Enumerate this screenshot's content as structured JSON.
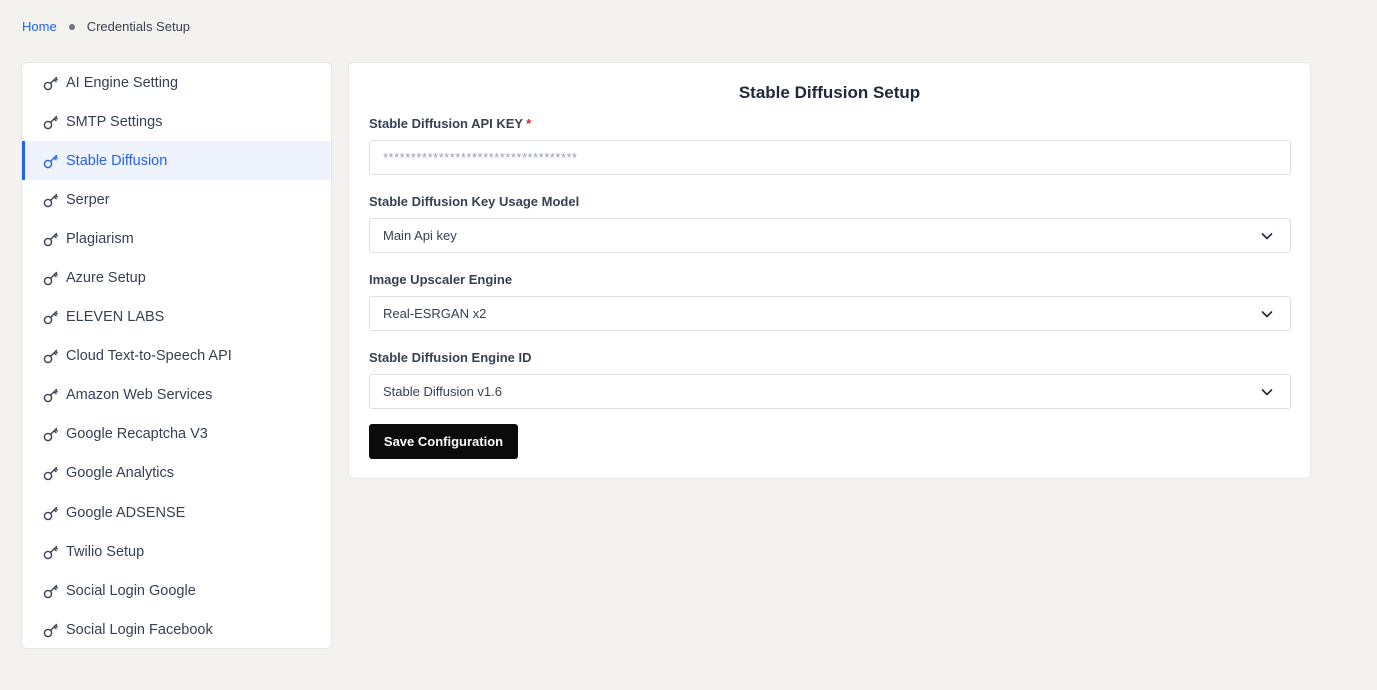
{
  "breadcrumb": {
    "home": "Home",
    "current": "Credentials Setup"
  },
  "sidebar": {
    "items": [
      {
        "label": "AI Engine Setting",
        "icon": "key-icon"
      },
      {
        "label": "SMTP Settings",
        "icon": "key-icon"
      },
      {
        "label": "Stable Diffusion",
        "icon": "key-icon",
        "active": true
      },
      {
        "label": "Serper",
        "icon": "key-icon"
      },
      {
        "label": "Plagiarism",
        "icon": "key-icon"
      },
      {
        "label": "Azure Setup",
        "icon": "key-icon"
      },
      {
        "label": "ELEVEN LABS",
        "icon": "key-icon"
      },
      {
        "label": "Cloud Text-to-Speech API",
        "icon": "key-icon"
      },
      {
        "label": "Amazon Web Services",
        "icon": "key-icon"
      },
      {
        "label": "Google Recaptcha V3",
        "icon": "key-icon"
      },
      {
        "label": "Google Analytics",
        "icon": "key-icon"
      },
      {
        "label": "Google ADSENSE",
        "icon": "key-icon"
      },
      {
        "label": "Twilio Setup",
        "icon": "key-icon"
      },
      {
        "label": "Social Login Google",
        "icon": "key-icon"
      },
      {
        "label": "Social Login Facebook",
        "icon": "key-icon"
      }
    ]
  },
  "form": {
    "title": "Stable Diffusion Setup",
    "api_key": {
      "label": "Stable Diffusion API KEY",
      "required_mark": "*",
      "value": "***********************************"
    },
    "usage_model": {
      "label": "Stable Diffusion Key Usage Model",
      "selected": "Main Api key"
    },
    "upscaler": {
      "label": "Image Upscaler Engine",
      "selected": "Real-ESRGAN x2"
    },
    "engine_id": {
      "label": "Stable Diffusion Engine ID",
      "selected": "Stable Diffusion v1.6"
    },
    "save_label": "Save Configuration"
  },
  "colors": {
    "accent": "#2563eb",
    "page_bg": "#f3f2ee",
    "button_bg": "#0b0b0c",
    "required": "#dc2626"
  }
}
